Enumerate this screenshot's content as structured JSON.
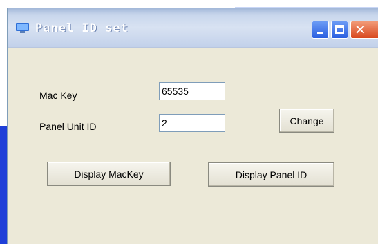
{
  "window": {
    "title": "Panel ID set",
    "icon": "app-window-icon",
    "controls": {
      "minimize": "minimize-icon",
      "maximize": "maximize-icon",
      "close": "close-icon"
    }
  },
  "form": {
    "mac_key_label": "Mac Key",
    "mac_key_value": "65535",
    "panel_unit_id_label": "Panel Unit ID",
    "panel_unit_id_value": "2"
  },
  "buttons": {
    "change": "Change",
    "display_mackey": "Display MacKey",
    "display_panel_id": "Display Panel ID"
  },
  "colors": {
    "dialog_bg": "#ece9d8",
    "close_button": "#d8481f",
    "title_button": "#2a5fe0"
  }
}
